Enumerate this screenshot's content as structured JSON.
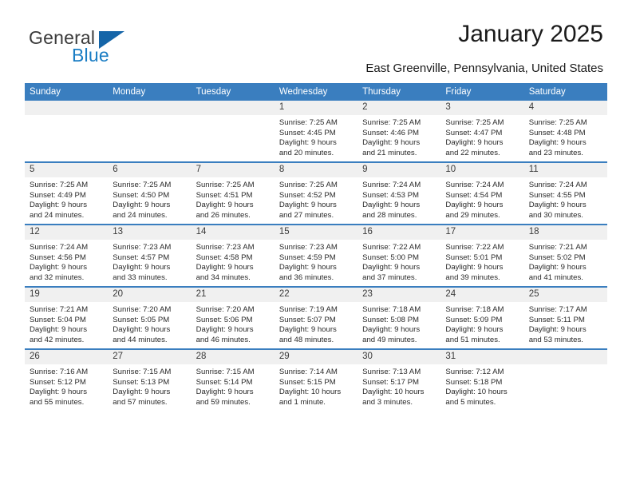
{
  "brand": {
    "name_part1": "General",
    "name_part2": "Blue"
  },
  "header": {
    "title": "January 2025",
    "location": "East Greenville, Pennsylvania, United States"
  },
  "calendar": {
    "weekday_headers": [
      "Sunday",
      "Monday",
      "Tuesday",
      "Wednesday",
      "Thursday",
      "Friday",
      "Saturday"
    ],
    "weeks": [
      [
        {
          "day": "",
          "sunrise": "",
          "sunset": "",
          "daylight_line1": "",
          "daylight_line2": "",
          "empty": true
        },
        {
          "day": "",
          "sunrise": "",
          "sunset": "",
          "daylight_line1": "",
          "daylight_line2": "",
          "empty": true
        },
        {
          "day": "",
          "sunrise": "",
          "sunset": "",
          "daylight_line1": "",
          "daylight_line2": "",
          "empty": true
        },
        {
          "day": "1",
          "sunrise": "Sunrise: 7:25 AM",
          "sunset": "Sunset: 4:45 PM",
          "daylight_line1": "Daylight: 9 hours",
          "daylight_line2": "and 20 minutes.",
          "empty": false
        },
        {
          "day": "2",
          "sunrise": "Sunrise: 7:25 AM",
          "sunset": "Sunset: 4:46 PM",
          "daylight_line1": "Daylight: 9 hours",
          "daylight_line2": "and 21 minutes.",
          "empty": false
        },
        {
          "day": "3",
          "sunrise": "Sunrise: 7:25 AM",
          "sunset": "Sunset: 4:47 PM",
          "daylight_line1": "Daylight: 9 hours",
          "daylight_line2": "and 22 minutes.",
          "empty": false
        },
        {
          "day": "4",
          "sunrise": "Sunrise: 7:25 AM",
          "sunset": "Sunset: 4:48 PM",
          "daylight_line1": "Daylight: 9 hours",
          "daylight_line2": "and 23 minutes.",
          "empty": false
        }
      ],
      [
        {
          "day": "5",
          "sunrise": "Sunrise: 7:25 AM",
          "sunset": "Sunset: 4:49 PM",
          "daylight_line1": "Daylight: 9 hours",
          "daylight_line2": "and 24 minutes.",
          "empty": false
        },
        {
          "day": "6",
          "sunrise": "Sunrise: 7:25 AM",
          "sunset": "Sunset: 4:50 PM",
          "daylight_line1": "Daylight: 9 hours",
          "daylight_line2": "and 24 minutes.",
          "empty": false
        },
        {
          "day": "7",
          "sunrise": "Sunrise: 7:25 AM",
          "sunset": "Sunset: 4:51 PM",
          "daylight_line1": "Daylight: 9 hours",
          "daylight_line2": "and 26 minutes.",
          "empty": false
        },
        {
          "day": "8",
          "sunrise": "Sunrise: 7:25 AM",
          "sunset": "Sunset: 4:52 PM",
          "daylight_line1": "Daylight: 9 hours",
          "daylight_line2": "and 27 minutes.",
          "empty": false
        },
        {
          "day": "9",
          "sunrise": "Sunrise: 7:24 AM",
          "sunset": "Sunset: 4:53 PM",
          "daylight_line1": "Daylight: 9 hours",
          "daylight_line2": "and 28 minutes.",
          "empty": false
        },
        {
          "day": "10",
          "sunrise": "Sunrise: 7:24 AM",
          "sunset": "Sunset: 4:54 PM",
          "daylight_line1": "Daylight: 9 hours",
          "daylight_line2": "and 29 minutes.",
          "empty": false
        },
        {
          "day": "11",
          "sunrise": "Sunrise: 7:24 AM",
          "sunset": "Sunset: 4:55 PM",
          "daylight_line1": "Daylight: 9 hours",
          "daylight_line2": "and 30 minutes.",
          "empty": false
        }
      ],
      [
        {
          "day": "12",
          "sunrise": "Sunrise: 7:24 AM",
          "sunset": "Sunset: 4:56 PM",
          "daylight_line1": "Daylight: 9 hours",
          "daylight_line2": "and 32 minutes.",
          "empty": false
        },
        {
          "day": "13",
          "sunrise": "Sunrise: 7:23 AM",
          "sunset": "Sunset: 4:57 PM",
          "daylight_line1": "Daylight: 9 hours",
          "daylight_line2": "and 33 minutes.",
          "empty": false
        },
        {
          "day": "14",
          "sunrise": "Sunrise: 7:23 AM",
          "sunset": "Sunset: 4:58 PM",
          "daylight_line1": "Daylight: 9 hours",
          "daylight_line2": "and 34 minutes.",
          "empty": false
        },
        {
          "day": "15",
          "sunrise": "Sunrise: 7:23 AM",
          "sunset": "Sunset: 4:59 PM",
          "daylight_line1": "Daylight: 9 hours",
          "daylight_line2": "and 36 minutes.",
          "empty": false
        },
        {
          "day": "16",
          "sunrise": "Sunrise: 7:22 AM",
          "sunset": "Sunset: 5:00 PM",
          "daylight_line1": "Daylight: 9 hours",
          "daylight_line2": "and 37 minutes.",
          "empty": false
        },
        {
          "day": "17",
          "sunrise": "Sunrise: 7:22 AM",
          "sunset": "Sunset: 5:01 PM",
          "daylight_line1": "Daylight: 9 hours",
          "daylight_line2": "and 39 minutes.",
          "empty": false
        },
        {
          "day": "18",
          "sunrise": "Sunrise: 7:21 AM",
          "sunset": "Sunset: 5:02 PM",
          "daylight_line1": "Daylight: 9 hours",
          "daylight_line2": "and 41 minutes.",
          "empty": false
        }
      ],
      [
        {
          "day": "19",
          "sunrise": "Sunrise: 7:21 AM",
          "sunset": "Sunset: 5:04 PM",
          "daylight_line1": "Daylight: 9 hours",
          "daylight_line2": "and 42 minutes.",
          "empty": false
        },
        {
          "day": "20",
          "sunrise": "Sunrise: 7:20 AM",
          "sunset": "Sunset: 5:05 PM",
          "daylight_line1": "Daylight: 9 hours",
          "daylight_line2": "and 44 minutes.",
          "empty": false
        },
        {
          "day": "21",
          "sunrise": "Sunrise: 7:20 AM",
          "sunset": "Sunset: 5:06 PM",
          "daylight_line1": "Daylight: 9 hours",
          "daylight_line2": "and 46 minutes.",
          "empty": false
        },
        {
          "day": "22",
          "sunrise": "Sunrise: 7:19 AM",
          "sunset": "Sunset: 5:07 PM",
          "daylight_line1": "Daylight: 9 hours",
          "daylight_line2": "and 48 minutes.",
          "empty": false
        },
        {
          "day": "23",
          "sunrise": "Sunrise: 7:18 AM",
          "sunset": "Sunset: 5:08 PM",
          "daylight_line1": "Daylight: 9 hours",
          "daylight_line2": "and 49 minutes.",
          "empty": false
        },
        {
          "day": "24",
          "sunrise": "Sunrise: 7:18 AM",
          "sunset": "Sunset: 5:09 PM",
          "daylight_line1": "Daylight: 9 hours",
          "daylight_line2": "and 51 minutes.",
          "empty": false
        },
        {
          "day": "25",
          "sunrise": "Sunrise: 7:17 AM",
          "sunset": "Sunset: 5:11 PM",
          "daylight_line1": "Daylight: 9 hours",
          "daylight_line2": "and 53 minutes.",
          "empty": false
        }
      ],
      [
        {
          "day": "26",
          "sunrise": "Sunrise: 7:16 AM",
          "sunset": "Sunset: 5:12 PM",
          "daylight_line1": "Daylight: 9 hours",
          "daylight_line2": "and 55 minutes.",
          "empty": false
        },
        {
          "day": "27",
          "sunrise": "Sunrise: 7:15 AM",
          "sunset": "Sunset: 5:13 PM",
          "daylight_line1": "Daylight: 9 hours",
          "daylight_line2": "and 57 minutes.",
          "empty": false
        },
        {
          "day": "28",
          "sunrise": "Sunrise: 7:15 AM",
          "sunset": "Sunset: 5:14 PM",
          "daylight_line1": "Daylight: 9 hours",
          "daylight_line2": "and 59 minutes.",
          "empty": false
        },
        {
          "day": "29",
          "sunrise": "Sunrise: 7:14 AM",
          "sunset": "Sunset: 5:15 PM",
          "daylight_line1": "Daylight: 10 hours",
          "daylight_line2": "and 1 minute.",
          "empty": false
        },
        {
          "day": "30",
          "sunrise": "Sunrise: 7:13 AM",
          "sunset": "Sunset: 5:17 PM",
          "daylight_line1": "Daylight: 10 hours",
          "daylight_line2": "and 3 minutes.",
          "empty": false
        },
        {
          "day": "31",
          "sunrise": "Sunrise: 7:12 AM",
          "sunset": "Sunset: 5:18 PM",
          "daylight_line1": "Daylight: 10 hours",
          "daylight_line2": "and 5 minutes.",
          "empty": false
        },
        {
          "day": "",
          "sunrise": "",
          "sunset": "",
          "daylight_line1": "",
          "daylight_line2": "",
          "empty": true
        }
      ]
    ]
  },
  "colors": {
    "header_blue": "#3a7ebf",
    "brand_blue": "#1a7dc4",
    "logo_triangle": "#1565a8",
    "daynum_bg": "#f0f0f0"
  }
}
